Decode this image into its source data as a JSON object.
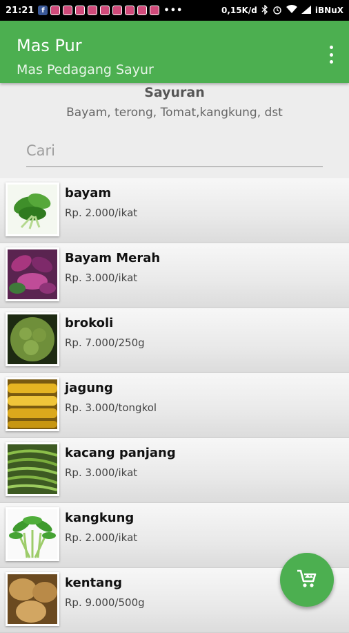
{
  "status_bar": {
    "time": "21:21",
    "net_speed": "0,15K/d",
    "carrier": "iBNuX",
    "notification_icons": [
      "facebook-icon",
      "instagram-icon",
      "instagram-icon",
      "instagram-icon",
      "instagram-icon",
      "instagram-icon",
      "instagram-icon",
      "instagram-icon",
      "instagram-icon",
      "instagram-icon"
    ],
    "more_indicator": "•••"
  },
  "app_bar": {
    "title": "Mas Pur",
    "subtitle": "Mas Pedagang Sayur",
    "color": "#4caf50"
  },
  "category": {
    "title": "Sayuran",
    "description": "Bayam, terong, Tomat,kangkung, dst"
  },
  "search": {
    "placeholder": "Cari",
    "value": ""
  },
  "products": [
    {
      "name": "bayam",
      "price": "Rp. 2.000/ikat",
      "image": "spinach-image"
    },
    {
      "name": "Bayam Merah",
      "price": "Rp. 3.000/ikat",
      "image": "red-spinach-image"
    },
    {
      "name": "brokoli",
      "price": "Rp. 7.000/250g",
      "image": "broccoli-image"
    },
    {
      "name": "jagung",
      "price": "Rp. 3.000/tongkol",
      "image": "corn-image"
    },
    {
      "name": "kacang panjang",
      "price": "Rp. 3.000/ikat",
      "image": "long-bean-image"
    },
    {
      "name": "kangkung",
      "price": "Rp. 2.000/ikat",
      "image": "water-spinach-image"
    },
    {
      "name": "kentang",
      "price": "Rp. 9.000/500g",
      "image": "potato-image"
    }
  ],
  "fab": {
    "icon": "cart-icon"
  }
}
